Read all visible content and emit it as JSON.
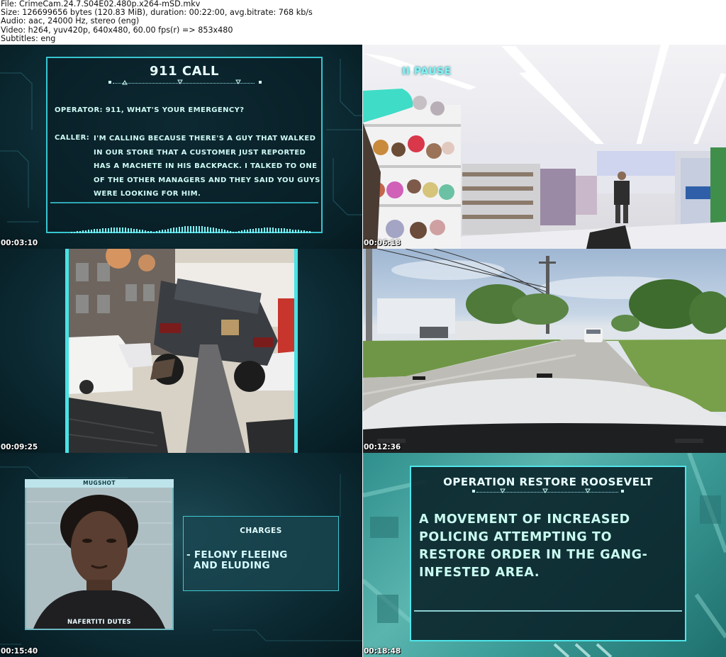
{
  "file_info": {
    "file": "File: CrimeCam.24.7.S04E02.480p.x264-mSD.mkv",
    "size": "Size: 126699656 bytes (120.83 MiB), duration: 00:22:00, avg.bitrate: 768 kb/s",
    "audio": "Audio: aac, 24000 Hz, stereo (eng)",
    "video": "Video: h264, yuv420p, 640x480, 60.00 fps(r) => 853x480",
    "subtitles": "Subtitles: eng"
  },
  "thumbnails": [
    {
      "timestamp": "00:03:10",
      "title": "911 CALL",
      "operator": "OPERATOR: 911, WHAT'S YOUR EMERGENCY?",
      "caller_label": "CALLER:",
      "caller_text": "I'M CALLING BECAUSE THERE'S A GUY THAT WALKED IN OUR STORE THAT A CUSTOMER JUST REPORTED HAS A MACHETE IN HIS BACKPACK. I TALKED TO ONE OF THE OTHER MANAGERS AND THEY SAID YOU GUYS WERE LOOKING FOR HIM."
    },
    {
      "timestamp": "00:06:18",
      "overlay": "II PAUSE"
    },
    {
      "timestamp": "00:09:25"
    },
    {
      "timestamp": "00:12:36"
    },
    {
      "timestamp": "00:15:40",
      "mugshot_label": "MUGSHOT",
      "name": "NAFERTITI DUTES",
      "charges_title": "CHARGES",
      "charges_item": "- FELONY FLEEING\n  AND ELUDING"
    },
    {
      "timestamp": "00:18:48",
      "title": "OPERATION RESTORE ROOSEVELT",
      "text": "A MOVEMENT OF INCREASED POLICING ATTEMPTING TO RESTORE ORDER IN THE GANG-INFESTED AREA."
    }
  ],
  "colors": {
    "accent": "#38c6d0",
    "panel_text": "#cffbf6",
    "teal_background": "#0c2a33"
  }
}
